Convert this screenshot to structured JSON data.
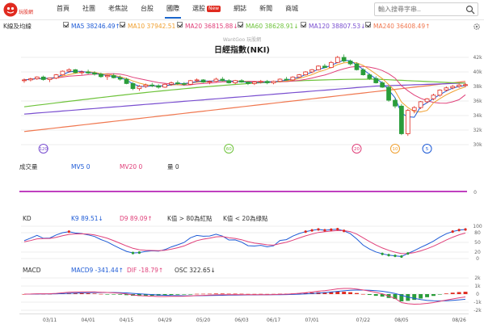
{
  "brand": {
    "sub_text": "玩股網"
  },
  "nav": {
    "items": [
      {
        "label": "首頁",
        "active": false
      },
      {
        "label": "社團",
        "active": false
      },
      {
        "label": "老焦說",
        "active": false
      },
      {
        "label": "台股",
        "active": false
      },
      {
        "label": "國際",
        "active": true
      },
      {
        "label": "選股",
        "active": false,
        "badge": "New"
      },
      {
        "label": "網誌",
        "active": false
      },
      {
        "label": "新聞",
        "active": false
      },
      {
        "label": "商城",
        "active": false
      }
    ]
  },
  "search": {
    "placeholder": "輸入搜尋字串.."
  },
  "legend": {
    "type_label": "K線及均線",
    "ma5": "MA5 38246.49↑",
    "ma10": "MA10 37942.51↑",
    "ma20": "MA20 36815.88↓",
    "ma60": "MA60 38628.91↓",
    "ma120": "MA120 38807.53↓",
    "ma240": "MA240 36408.49↑"
  },
  "chart": {
    "watermark": "WantGoo 玩股網",
    "title": "日經指數(NKI)"
  },
  "colors": {
    "up": "#e02a1f",
    "down": "#2a9d3a",
    "ma5": "#1e5bd6",
    "ma10": "#f0a030",
    "ma20": "#e0407a",
    "ma60": "#6fc33c",
    "ma120": "#7a4fd0",
    "ma240": "#f07850",
    "volume": "#c040c0",
    "k": "#1e5bd6",
    "d": "#e0407a"
  },
  "price_axis": [
    "42k",
    "40k",
    "38k",
    "36k",
    "34k",
    "32k",
    "30k"
  ],
  "event_markers": [
    "120",
    "60",
    "20",
    "10",
    "5"
  ],
  "volume_panel": {
    "label": "成交量",
    "ma5": "MV5 0",
    "ma20": "MV20 0",
    "vol": "量 0",
    "axis": [
      "0"
    ]
  },
  "kd_panel": {
    "label": "KD",
    "k": "K9 89.51↓",
    "d": "D9 89.09↑",
    "note1": "K值 > 80為紅點",
    "note2": "K值 < 20為綠點",
    "axis": [
      "100",
      "80",
      "50",
      "20",
      "0"
    ]
  },
  "macd_panel": {
    "label": "MACD",
    "macd": "MACD9 -341.44↑",
    "dif": "DIF -18.79↑",
    "osc": "OSC 322.65↓",
    "axis": [
      "2k",
      "1k",
      "0",
      "-1k",
      "-2k"
    ]
  },
  "dates": [
    "03/11",
    "04/01",
    "04/15",
    "04/29",
    "05/20",
    "06/03",
    "06/17",
    "07/01",
    "07/22",
    "08/05",
    "08/26"
  ],
  "chart_data": {
    "type": "candlestick",
    "title": "日經指數(NKI)",
    "ylim": [
      29000,
      43000
    ],
    "points": [
      [
        38820,
        39100,
        38500,
        38900
      ],
      [
        38900,
        39200,
        38700,
        39050
      ],
      [
        39050,
        39400,
        38900,
        39300
      ],
      [
        39300,
        39500,
        38800,
        38950
      ],
      [
        38950,
        39200,
        38600,
        39150
      ],
      [
        39150,
        39700,
        39000,
        39600
      ],
      [
        39600,
        40200,
        39500,
        40100
      ],
      [
        40100,
        40500,
        39900,
        40300
      ],
      [
        40300,
        40400,
        39800,
        39900
      ],
      [
        39900,
        40200,
        39600,
        40000
      ],
      [
        40000,
        40300,
        39700,
        39850
      ],
      [
        39850,
        40100,
        39500,
        39700
      ],
      [
        39700,
        39900,
        39200,
        39350
      ],
      [
        39350,
        39600,
        38900,
        39500
      ],
      [
        39500,
        39800,
        39100,
        39200
      ],
      [
        39200,
        39500,
        38800,
        39000
      ],
      [
        39000,
        39200,
        38300,
        38400
      ],
      [
        38400,
        38600,
        37500,
        37700
      ],
      [
        37700,
        38200,
        37400,
        38000
      ],
      [
        38000,
        38400,
        37800,
        38200
      ],
      [
        38200,
        38500,
        37900,
        38100
      ],
      [
        38100,
        38300,
        37700,
        37900
      ],
      [
        37900,
        38400,
        37800,
        38300
      ],
      [
        38300,
        38700,
        38100,
        38500
      ],
      [
        38500,
        38800,
        38200,
        38400
      ],
      [
        38400,
        38600,
        38100,
        38300
      ],
      [
        38300,
        38900,
        38200,
        38800
      ],
      [
        38800,
        39100,
        38600,
        38900
      ],
      [
        38900,
        39000,
        38500,
        38600
      ],
      [
        38600,
        38800,
        38300,
        38700
      ],
      [
        38700,
        39200,
        38600,
        39000
      ],
      [
        39000,
        39300,
        38700,
        38800
      ],
      [
        38800,
        39000,
        38400,
        38500
      ],
      [
        38500,
        38900,
        38300,
        38800
      ],
      [
        38800,
        39000,
        38500,
        38600
      ],
      [
        38600,
        38700,
        38200,
        38400
      ],
      [
        38400,
        38700,
        38200,
        38600
      ],
      [
        38600,
        38900,
        38400,
        38700
      ],
      [
        38700,
        38900,
        38300,
        38500
      ],
      [
        38500,
        38800,
        38300,
        38700
      ],
      [
        38700,
        39100,
        38600,
        39000
      ],
      [
        39000,
        39300,
        38800,
        38900
      ],
      [
        38900,
        39400,
        38800,
        39300
      ],
      [
        39300,
        39700,
        39200,
        39600
      ],
      [
        39600,
        40100,
        39500,
        40000
      ],
      [
        40000,
        40400,
        39800,
        40300
      ],
      [
        40300,
        40900,
        40200,
        40800
      ],
      [
        40800,
        41100,
        40500,
        40600
      ],
      [
        40600,
        41500,
        40500,
        41300
      ],
      [
        41300,
        42200,
        41200,
        42000
      ],
      [
        42000,
        42400,
        41300,
        41500
      ],
      [
        41500,
        41700,
        40900,
        41100
      ],
      [
        41100,
        41300,
        40200,
        40300
      ],
      [
        40300,
        40500,
        39500,
        39600
      ],
      [
        39600,
        39800,
        38900,
        39100
      ],
      [
        39100,
        39400,
        38400,
        38500
      ],
      [
        38500,
        38700,
        37800,
        37900
      ],
      [
        37900,
        38100,
        35900,
        36100
      ],
      [
        36100,
        36400,
        35000,
        35300
      ],
      [
        35300,
        35600,
        31300,
        31500
      ],
      [
        31500,
        34900,
        31200,
        34700
      ],
      [
        34700,
        35300,
        34300,
        35100
      ],
      [
        35100,
        36000,
        34900,
        35900
      ],
      [
        35900,
        36400,
        35700,
        36300
      ],
      [
        36300,
        37000,
        36100,
        36800
      ],
      [
        36800,
        37600,
        36600,
        37500
      ],
      [
        37500,
        38000,
        37300,
        37800
      ],
      [
        37800,
        38200,
        37600,
        38000
      ],
      [
        38000,
        38400,
        37800,
        38200
      ],
      [
        38200,
        38500,
        37900,
        38246
      ]
    ]
  }
}
